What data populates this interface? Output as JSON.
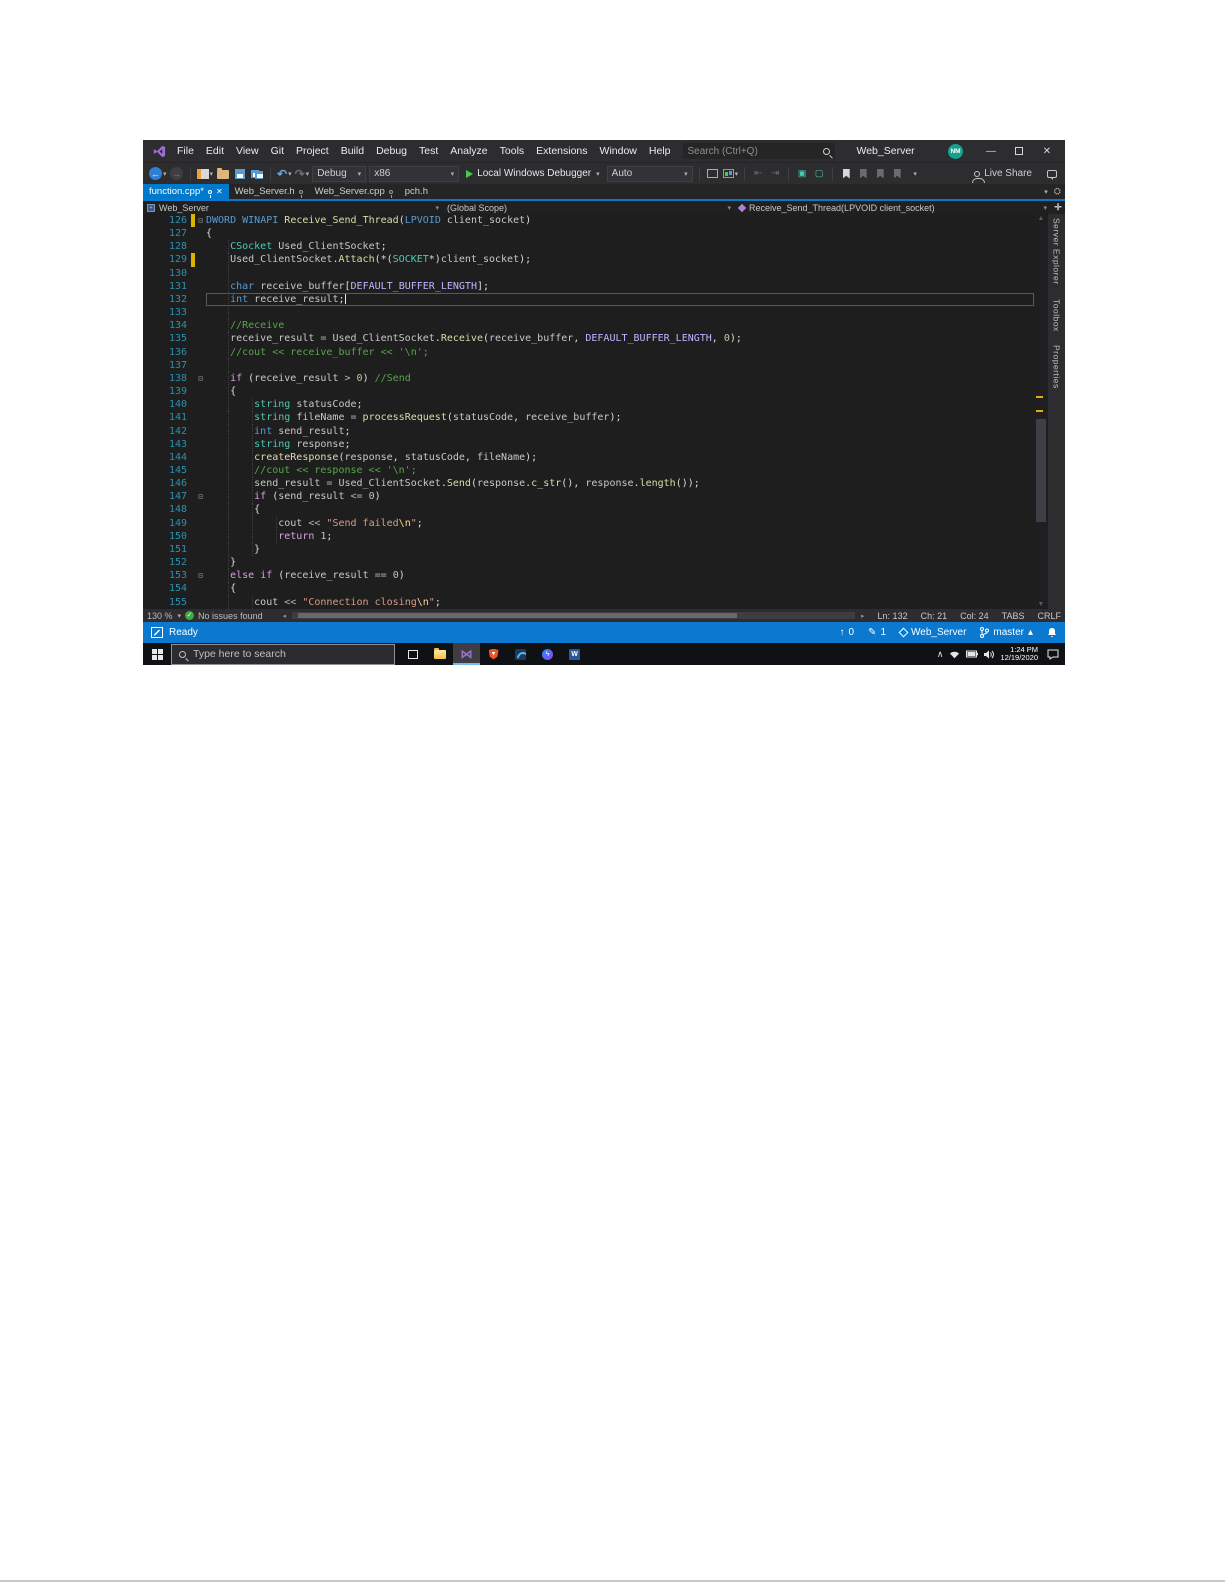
{
  "window": {
    "title": "Web_Server",
    "search_placeholder": "Search (Ctrl+Q)",
    "avatar": "NM",
    "menu": [
      "File",
      "Edit",
      "View",
      "Git",
      "Project",
      "Build",
      "Debug",
      "Test",
      "Analyze",
      "Tools",
      "Extensions",
      "Window",
      "Help"
    ]
  },
  "toolbar": {
    "config": "Debug",
    "platform": "x86",
    "run": "Local Windows Debugger",
    "auto": "Auto",
    "live_share": "Live Share"
  },
  "tabs": [
    {
      "label": "function.cpp*",
      "active": true,
      "pinned": true,
      "closable": true
    },
    {
      "label": "Web_Server.h",
      "active": false,
      "pinned": true,
      "closable": false
    },
    {
      "label": "Web_Server.cpp",
      "active": false,
      "pinned": true,
      "closable": false
    },
    {
      "label": "pch.h",
      "active": false,
      "pinned": false,
      "closable": false
    }
  ],
  "navbar": {
    "project": "Web_Server",
    "scope": "(Global Scope)",
    "member": "Receive_Send_Thread(LPVOID client_socket)"
  },
  "side_tabs": [
    "Server Explorer",
    "Toolbox",
    "Properties"
  ],
  "editor": {
    "zoom": "130 %",
    "issues": "No issues found",
    "position": {
      "ln": "Ln: 132",
      "ch": "Ch: 21",
      "col": "Col: 24",
      "tabs": "TABS",
      "eol": "CRLF"
    },
    "code": [
      {
        "n": 126,
        "ind": 0,
        "fold": true,
        "chg": true,
        "g": [],
        "tk": [
          [
            "k",
            "DWORD"
          ],
          [
            "p",
            " "
          ],
          [
            "k",
            "WINAPI"
          ],
          [
            "p",
            " "
          ],
          [
            "f",
            "Receive_Send_Thread"
          ],
          [
            "p",
            "("
          ],
          [
            "k",
            "LPVOID"
          ],
          [
            "p",
            " "
          ],
          [
            "v",
            "client_socket"
          ],
          [
            "p",
            ")"
          ]
        ]
      },
      {
        "n": 127,
        "ind": 0,
        "g": [],
        "tk": [
          [
            "p",
            "{"
          ]
        ]
      },
      {
        "n": 128,
        "ind": 4,
        "g": [
          3.6
        ],
        "tk": [
          [
            "t",
            "CSocket"
          ],
          [
            "p",
            " "
          ],
          [
            "v",
            "Used_ClientSocket"
          ],
          [
            "p",
            ";"
          ]
        ]
      },
      {
        "n": 129,
        "ind": 4,
        "chg": true,
        "g": [
          3.6
        ],
        "tk": [
          [
            "v",
            "Used_ClientSocket"
          ],
          [
            "p",
            "."
          ],
          [
            "f",
            "Attach"
          ],
          [
            "p",
            "(*("
          ],
          [
            "t",
            "SOCKET"
          ],
          [
            "p",
            "*)"
          ],
          [
            "v",
            "client_socket"
          ],
          [
            "p",
            ");"
          ]
        ]
      },
      {
        "n": 130,
        "ind": 0,
        "g": [
          3.6
        ],
        "tk": []
      },
      {
        "n": 131,
        "ind": 4,
        "g": [
          3.6
        ],
        "tk": [
          [
            "k",
            "char"
          ],
          [
            "p",
            " "
          ],
          [
            "v",
            "receive_buffer"
          ],
          [
            "p",
            "["
          ],
          [
            "m",
            "DEFAULT_BUFFER_LENGTH"
          ],
          [
            "p",
            "];"
          ]
        ]
      },
      {
        "n": 132,
        "ind": 4,
        "cur": true,
        "caret": true,
        "g": [
          3.6
        ],
        "tk": [
          [
            "k",
            "int"
          ],
          [
            "p",
            " "
          ],
          [
            "v",
            "receive_result"
          ],
          [
            "p",
            ";"
          ]
        ]
      },
      {
        "n": 133,
        "ind": 0,
        "g": [
          3.6
        ],
        "tk": []
      },
      {
        "n": 134,
        "ind": 4,
        "g": [
          3.6
        ],
        "tk": [
          [
            "c",
            "//Receive"
          ]
        ]
      },
      {
        "n": 135,
        "ind": 4,
        "g": [
          3.6
        ],
        "tk": [
          [
            "v",
            "receive_result"
          ],
          [
            "o",
            " = "
          ],
          [
            "v",
            "Used_ClientSocket"
          ],
          [
            "p",
            "."
          ],
          [
            "f",
            "Receive"
          ],
          [
            "p",
            "("
          ],
          [
            "v",
            "receive_buffer"
          ],
          [
            "p",
            ", "
          ],
          [
            "m",
            "DEFAULT_BUFFER_LENGTH"
          ],
          [
            "p",
            ", "
          ],
          [
            "n",
            "0"
          ],
          [
            "p",
            ");"
          ]
        ]
      },
      {
        "n": 136,
        "ind": 4,
        "g": [
          3.6
        ],
        "tk": [
          [
            "c",
            "//cout << receive_buffer << '\\n';"
          ]
        ]
      },
      {
        "n": 137,
        "ind": 0,
        "g": [
          3.6
        ],
        "tk": []
      },
      {
        "n": 138,
        "ind": 4,
        "fold": true,
        "g": [
          3.6
        ],
        "tk": [
          [
            "ctl",
            "if"
          ],
          [
            "p",
            " ("
          ],
          [
            "v",
            "receive_result"
          ],
          [
            "o",
            " > "
          ],
          [
            "n",
            "0"
          ],
          [
            "p",
            ") "
          ],
          [
            "c",
            "//Send"
          ]
        ]
      },
      {
        "n": 139,
        "ind": 4,
        "g": [
          3.6
        ],
        "tk": [
          [
            "p",
            "{"
          ]
        ]
      },
      {
        "n": 140,
        "ind": 8,
        "g": [
          3.6,
          7.6
        ],
        "tk": [
          [
            "t",
            "string"
          ],
          [
            "p",
            " "
          ],
          [
            "v",
            "statusCode"
          ],
          [
            "p",
            ";"
          ]
        ]
      },
      {
        "n": 141,
        "ind": 8,
        "g": [
          3.6,
          7.6
        ],
        "tk": [
          [
            "t",
            "string"
          ],
          [
            "p",
            " "
          ],
          [
            "v",
            "fileName"
          ],
          [
            "o",
            " = "
          ],
          [
            "f",
            "processRequest"
          ],
          [
            "p",
            "("
          ],
          [
            "v",
            "statusCode"
          ],
          [
            "p",
            ", "
          ],
          [
            "v",
            "receive_buffer"
          ],
          [
            "p",
            ");"
          ]
        ]
      },
      {
        "n": 142,
        "ind": 8,
        "g": [
          3.6,
          7.6
        ],
        "tk": [
          [
            "k",
            "int"
          ],
          [
            "p",
            " "
          ],
          [
            "v",
            "send_result"
          ],
          [
            "p",
            ";"
          ]
        ]
      },
      {
        "n": 143,
        "ind": 8,
        "g": [
          3.6,
          7.6
        ],
        "tk": [
          [
            "t",
            "string"
          ],
          [
            "p",
            " "
          ],
          [
            "v",
            "response"
          ],
          [
            "p",
            ";"
          ]
        ]
      },
      {
        "n": 144,
        "ind": 8,
        "g": [
          3.6,
          7.6
        ],
        "tk": [
          [
            "f",
            "createResponse"
          ],
          [
            "p",
            "("
          ],
          [
            "v",
            "response"
          ],
          [
            "p",
            ", "
          ],
          [
            "v",
            "statusCode"
          ],
          [
            "p",
            ", "
          ],
          [
            "v",
            "fileName"
          ],
          [
            "p",
            ");"
          ]
        ]
      },
      {
        "n": 145,
        "ind": 8,
        "g": [
          3.6,
          7.6
        ],
        "tk": [
          [
            "c",
            "//cout << response << '\\n';"
          ]
        ]
      },
      {
        "n": 146,
        "ind": 8,
        "g": [
          3.6,
          7.6
        ],
        "tk": [
          [
            "v",
            "send_result"
          ],
          [
            "o",
            " = "
          ],
          [
            "v",
            "Used_ClientSocket"
          ],
          [
            "p",
            "."
          ],
          [
            "f",
            "Send"
          ],
          [
            "p",
            "("
          ],
          [
            "v",
            "response"
          ],
          [
            "p",
            "."
          ],
          [
            "f",
            "c_str"
          ],
          [
            "p",
            "(), "
          ],
          [
            "v",
            "response"
          ],
          [
            "p",
            "."
          ],
          [
            "f",
            "length"
          ],
          [
            "p",
            "());"
          ]
        ]
      },
      {
        "n": 147,
        "ind": 8,
        "fold": true,
        "g": [
          3.6,
          7.6
        ],
        "tk": [
          [
            "ctl",
            "if"
          ],
          [
            "p",
            " ("
          ],
          [
            "v",
            "send_result"
          ],
          [
            "o",
            " <= "
          ],
          [
            "n",
            "0"
          ],
          [
            "p",
            ")"
          ]
        ]
      },
      {
        "n": 148,
        "ind": 8,
        "g": [
          3.6,
          7.6
        ],
        "tk": [
          [
            "p",
            "{"
          ]
        ]
      },
      {
        "n": 149,
        "ind": 12,
        "g": [
          3.6,
          7.6,
          11.6
        ],
        "tk": [
          [
            "v",
            "cout"
          ],
          [
            "o",
            " << "
          ],
          [
            "s",
            "\"Send failed"
          ],
          [
            "e",
            "\\n"
          ],
          [
            "s",
            "\""
          ],
          [
            "p",
            ";"
          ]
        ]
      },
      {
        "n": 150,
        "ind": 12,
        "g": [
          3.6,
          7.6,
          11.6
        ],
        "tk": [
          [
            "ctl",
            "return"
          ],
          [
            "p",
            " "
          ],
          [
            "n",
            "1"
          ],
          [
            "p",
            ";"
          ]
        ]
      },
      {
        "n": 151,
        "ind": 8,
        "g": [
          3.6,
          7.6
        ],
        "tk": [
          [
            "p",
            "}"
          ]
        ]
      },
      {
        "n": 152,
        "ind": 4,
        "g": [
          3.6
        ],
        "tk": [
          [
            "p",
            "}"
          ]
        ]
      },
      {
        "n": 153,
        "ind": 4,
        "fold": true,
        "g": [
          3.6
        ],
        "tk": [
          [
            "ctl",
            "else"
          ],
          [
            "p",
            " "
          ],
          [
            "ctl",
            "if"
          ],
          [
            "p",
            " ("
          ],
          [
            "v",
            "receive_result"
          ],
          [
            "o",
            " == "
          ],
          [
            "n",
            "0"
          ],
          [
            "p",
            ")"
          ]
        ]
      },
      {
        "n": 154,
        "ind": 4,
        "g": [
          3.6
        ],
        "tk": [
          [
            "p",
            "{"
          ]
        ]
      },
      {
        "n": 155,
        "ind": 8,
        "g": [
          3.6,
          7.6
        ],
        "tk": [
          [
            "v",
            "cout"
          ],
          [
            "o",
            " << "
          ],
          [
            "s",
            "\"Connection closing"
          ],
          [
            "e",
            "\\n"
          ],
          [
            "s",
            "\""
          ],
          [
            "p",
            ";"
          ]
        ]
      }
    ]
  },
  "statusbar": {
    "ready": "Ready",
    "up_count": "0",
    "edit_count": "1",
    "repo": "Web_Server",
    "branch": "master"
  },
  "taskbar": {
    "search_placeholder": "Type here to search",
    "apps": [
      "task-view",
      "file-explorer",
      "visual-studio",
      "brave",
      "blue-app",
      "messenger",
      "word"
    ],
    "active_app": "visual-studio",
    "time": "1:24 PM",
    "date": "12/19/2020"
  }
}
